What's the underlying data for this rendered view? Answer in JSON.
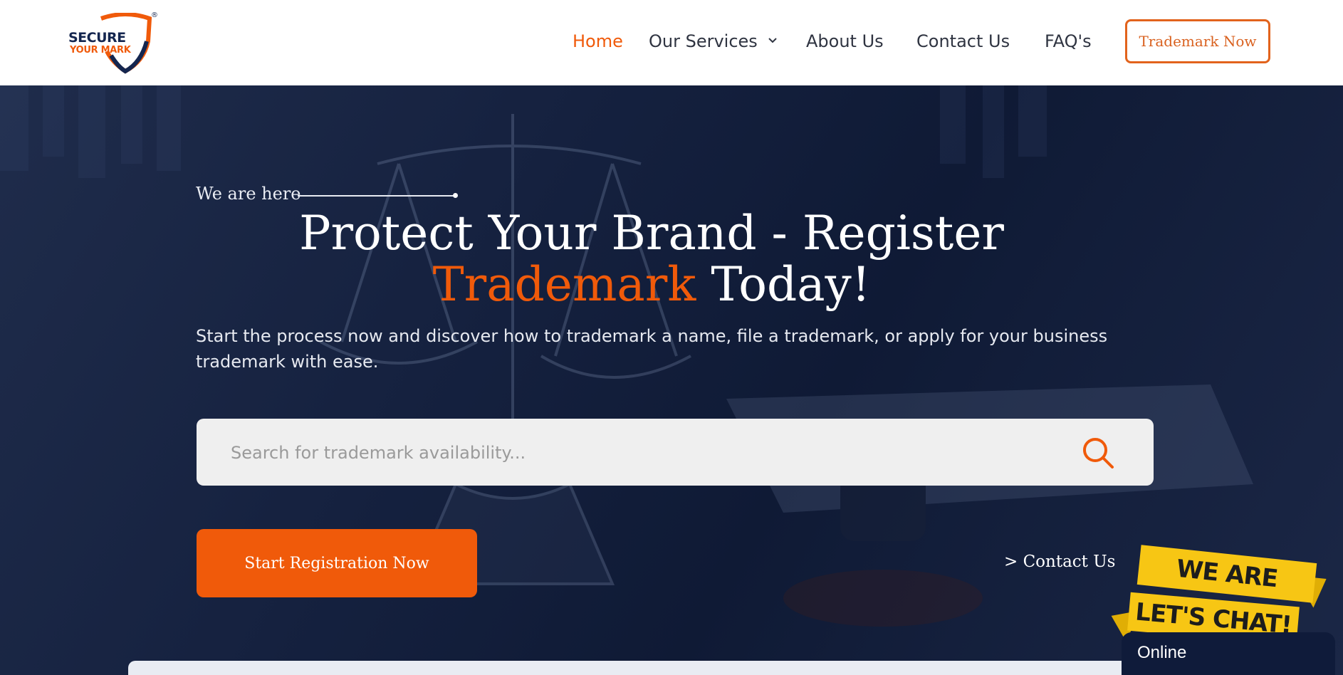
{
  "brand": {
    "line1": "SECURE",
    "line2": "YOUR MARK",
    "registered": "®",
    "colors": {
      "navy": "#14264f",
      "orange": "#f05a0a"
    }
  },
  "nav": {
    "items": [
      {
        "label": "Home",
        "active": true
      },
      {
        "label": "Our Services",
        "has_dropdown": true
      },
      {
        "label": "About Us"
      },
      {
        "label": "Contact Us"
      },
      {
        "label": "FAQ's"
      }
    ],
    "cta_label": "Trademark Now"
  },
  "hero": {
    "eyebrow": "We are here",
    "headline_part1": "Protect Your Brand - Register",
    "headline_accent": "Trademark",
    "headline_part2": "Today!",
    "subtext": "Start the process now and discover how to trademark a name, file a trademark, or apply for your business trademark with ease.",
    "search": {
      "placeholder": "Search for trademark availability...",
      "value": ""
    },
    "primary_cta": "Start Registration Now",
    "secondary_link": "> Contact Us"
  },
  "chat_widget": {
    "banner_line1": "WE ARE HERE!",
    "banner_line2": "LET'S CHAT!",
    "status": "Online"
  },
  "icons": {
    "search": "search-icon",
    "dropdown": "chevron-down-icon",
    "logo_shield": "shield-icon"
  }
}
